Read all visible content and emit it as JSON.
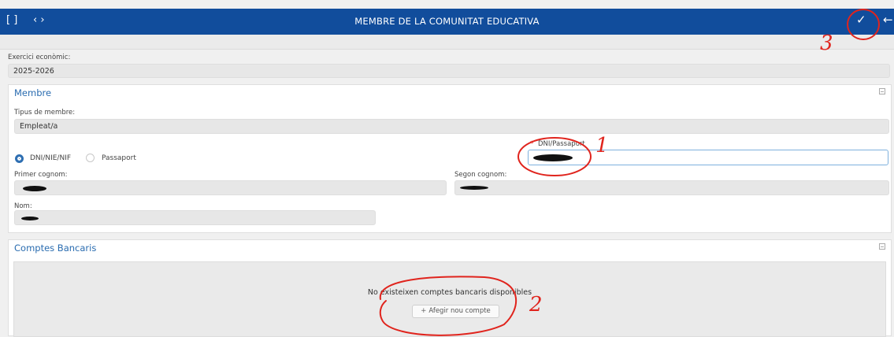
{
  "header": {
    "title": "MEMBRE DE LA COMUNITAT EDUCATIVA",
    "icons": {
      "expand": "expand-icon",
      "code": "code-icon",
      "confirm": "check-icon",
      "back": "back-arrow-icon"
    },
    "glyphs": {
      "expand": "[ ]",
      "code": "‹ ›",
      "confirm": "✓",
      "back": "←"
    }
  },
  "exercici": {
    "label": "Exercici econòmic:",
    "value": "2025-2026"
  },
  "membre": {
    "title": "Membre",
    "tipus_label": "Tipus de membre:",
    "tipus_value": "Empleat/a",
    "radio_options": [
      "DNI/NIE/NIF",
      "Passaport"
    ],
    "radio_selected": "DNI/NIE/NIF",
    "dni_label": "DNI/Passaport",
    "required_mark": "*",
    "primer_cognom_label": "Primer cognom:",
    "segon_cognom_label": "Segon cognom:",
    "nom_label": "Nom:"
  },
  "comptes": {
    "title": "Comptes Bancaris",
    "empty_message": "No existeixen comptes bancaris disponibles",
    "add_plus": "+",
    "add_label": "Afegir nou compte"
  },
  "annotations": [
    "1",
    "2",
    "3"
  ],
  "colors": {
    "header": "#114d9c",
    "accent": "#2a6cb0",
    "annotation": "#e0241d"
  }
}
